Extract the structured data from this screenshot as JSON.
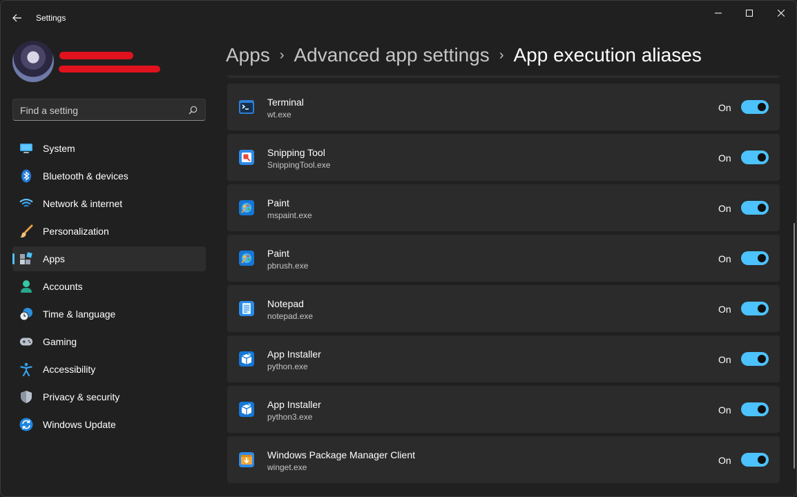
{
  "window": {
    "title": "Settings",
    "accent": "#4cc2ff",
    "controls": {
      "minimize_icon": "minimize-icon",
      "maximize_icon": "maximize-icon",
      "close_icon": "close-icon"
    }
  },
  "search": {
    "placeholder": "Find a setting",
    "icon": "search-icon"
  },
  "sidebar": {
    "items": [
      {
        "label": "System",
        "icon": "system-icon",
        "active": false
      },
      {
        "label": "Bluetooth & devices",
        "icon": "bluetooth-icon",
        "active": false
      },
      {
        "label": "Network & internet",
        "icon": "wifi-icon",
        "active": false
      },
      {
        "label": "Personalization",
        "icon": "brush-icon",
        "active": false
      },
      {
        "label": "Apps",
        "icon": "apps-icon",
        "active": true
      },
      {
        "label": "Accounts",
        "icon": "accounts-icon",
        "active": false
      },
      {
        "label": "Time & language",
        "icon": "time-language-icon",
        "active": false
      },
      {
        "label": "Gaming",
        "icon": "gaming-icon",
        "active": false
      },
      {
        "label": "Accessibility",
        "icon": "accessibility-icon",
        "active": false
      },
      {
        "label": "Privacy & security",
        "icon": "shield-icon",
        "active": false
      },
      {
        "label": "Windows Update",
        "icon": "update-icon",
        "active": false
      }
    ]
  },
  "breadcrumb": {
    "items": [
      "Apps",
      "Advanced app settings"
    ],
    "current": "App execution aliases"
  },
  "aliases": [
    {
      "name": "Terminal",
      "exe": "wt.exe",
      "state": "On",
      "enabled": true,
      "icon": "terminal-icon"
    },
    {
      "name": "Snipping Tool",
      "exe": "SnippingTool.exe",
      "state": "On",
      "enabled": true,
      "icon": "snipping-tool-icon"
    },
    {
      "name": "Paint",
      "exe": "mspaint.exe",
      "state": "On",
      "enabled": true,
      "icon": "paint-icon"
    },
    {
      "name": "Paint",
      "exe": "pbrush.exe",
      "state": "On",
      "enabled": true,
      "icon": "paint-icon"
    },
    {
      "name": "Notepad",
      "exe": "notepad.exe",
      "state": "On",
      "enabled": true,
      "icon": "notepad-icon"
    },
    {
      "name": "App Installer",
      "exe": "python.exe",
      "state": "On",
      "enabled": true,
      "icon": "app-installer-icon"
    },
    {
      "name": "App Installer",
      "exe": "python3.exe",
      "state": "On",
      "enabled": true,
      "icon": "app-installer-icon"
    },
    {
      "name": "Windows Package Manager Client",
      "exe": "winget.exe",
      "state": "On",
      "enabled": true,
      "icon": "package-manager-icon"
    }
  ]
}
